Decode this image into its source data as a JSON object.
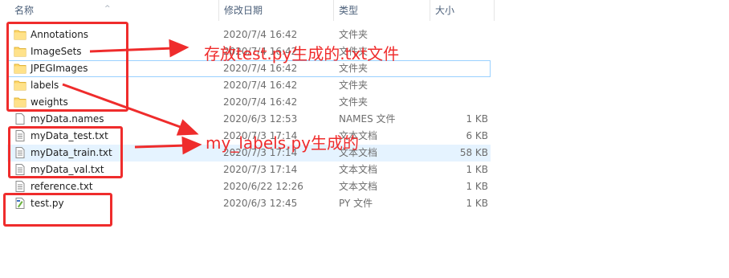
{
  "columns": {
    "name": "名称",
    "date": "修改日期",
    "type": "类型",
    "size": "大小"
  },
  "files": [
    {
      "name": "Annotations",
      "date": "2020/7/4 16:42",
      "type": "文件夹",
      "size": "",
      "icon": "folder-icon"
    },
    {
      "name": "ImageSets",
      "date": "2020/7/4 16:42",
      "type": "文件夹",
      "size": "",
      "icon": "folder-icon"
    },
    {
      "name": "JPEGImages",
      "date": "2020/7/4 16:42",
      "type": "文件夹",
      "size": "",
      "icon": "folder-icon"
    },
    {
      "name": "labels",
      "date": "2020/7/4 16:42",
      "type": "文件夹",
      "size": "",
      "icon": "folder-icon"
    },
    {
      "name": "weights",
      "date": "2020/7/4 16:42",
      "type": "文件夹",
      "size": "",
      "icon": "folder-icon"
    },
    {
      "name": "myData.names",
      "date": "2020/6/3 12:53",
      "type": "NAMES 文件",
      "size": "1 KB",
      "icon": "file-icon"
    },
    {
      "name": "myData_test.txt",
      "date": "2020/7/3 17:14",
      "type": "文本文档",
      "size": "6 KB",
      "icon": "text-file-icon"
    },
    {
      "name": "myData_train.txt",
      "date": "2020/7/3 17:14",
      "type": "文本文档",
      "size": "58 KB",
      "icon": "text-file-icon"
    },
    {
      "name": "myData_val.txt",
      "date": "2020/7/3 17:14",
      "type": "文本文档",
      "size": "1 KB",
      "icon": "text-file-icon"
    },
    {
      "name": "reference.txt",
      "date": "2020/6/22 12:26",
      "type": "文本文档",
      "size": "1 KB",
      "icon": "text-file-icon"
    },
    {
      "name": "test.py",
      "date": "2020/6/3 12:45",
      "type": "PY 文件",
      "size": "1 KB",
      "icon": "python-file-icon"
    }
  ],
  "annotations": {
    "label_1": "存放test.py生成的.txt文件",
    "label_2": "my_labels.py生成的"
  },
  "colors": {
    "annotation": "#ef2c2c",
    "selection_fill": "#e5f3ff",
    "selection_border": "#99d1ff",
    "folder": "#ffd766"
  }
}
